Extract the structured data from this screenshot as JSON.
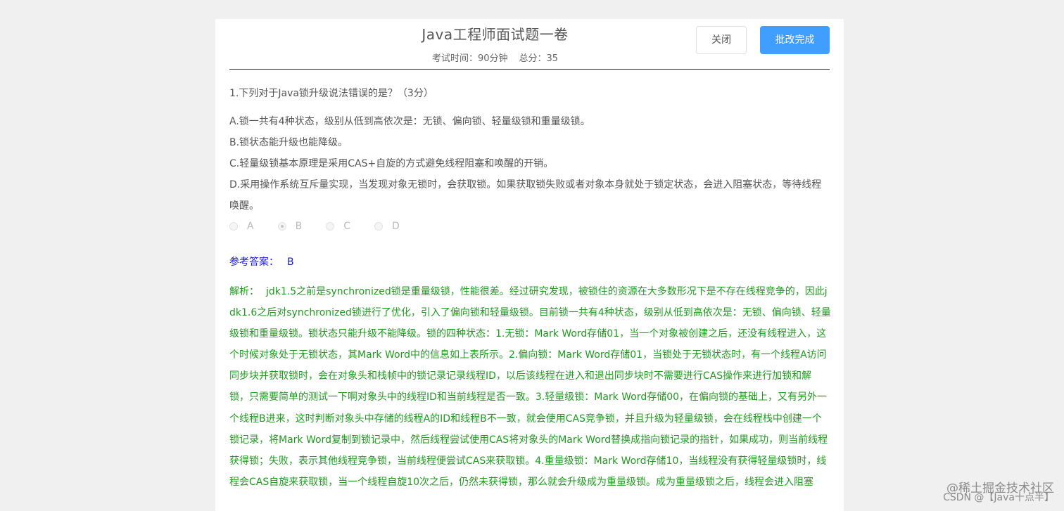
{
  "header": {
    "title": "Java工程师面试题一卷",
    "exam_time": "考试时间：90分钟",
    "total_score": "总分：35",
    "close_label": "关闭",
    "done_label": "批改完成"
  },
  "question": {
    "text": "1.下列对于Java锁升级说法错误的是？（3分）",
    "options": [
      "A.锁一共有4种状态，级别从低到高依次是：无锁、偏向锁、轻量级锁和重量级锁。",
      "B.锁状态能升级也能降级。",
      "C.轻量级锁基本原理是采用CAS+自旋的方式避免线程阻塞和唤醒的开销。",
      "D.采用操作系统互斥量实现，当发现对象无锁时，会获取锁。如果获取锁失败或者对象本身就处于锁定状态，会进入阻塞状态，等待线程唤醒。"
    ],
    "choices": [
      "A",
      "B",
      "C",
      "D"
    ],
    "selected": "B"
  },
  "answer": {
    "label": "参考答案：",
    "value": "B"
  },
  "analysis": {
    "label": "解析：",
    "text": "jdk1.5之前是synchronized锁是重量级锁，性能很差。经过研究发现，被锁住的资源在大多数形况下是不存在线程竞争的，因此jdk1.6之后对synchronized锁进行了优化，引入了偏向锁和轻量级锁。目前锁一共有4种状态，级别从低到高依次是：无锁、偏向锁、轻量级锁和重量级锁。锁状态只能升级不能降级。锁的四种状态：1.无锁：Mark Word存储01，当一个对象被创建之后，还没有线程进入，这个时候对象处于无锁状态，其Mark Word中的信息如上表所示。2.偏向锁：Mark Word存储01，当锁处于无锁状态时，有一个线程A访问同步块并获取锁时，会在对象头和栈帧中的锁记录记录线程ID，以后该线程在进入和退出同步块时不需要进行CAS操作来进行加锁和解锁，只需要简单的测试一下啊对象头中的线程ID和当前线程是否一致。3.轻量级锁：Mark Word存储00，在偏向锁的基础上，又有另外一个线程B进来，这时判断对象头中存储的线程A的ID和线程B不一致，就会使用CAS竞争锁，并且升级为轻量级锁，会在线程栈中创建一个锁记录，将Mark Word复制到锁记录中，然后线程尝试使用CAS将对象头的Mark Word替换成指向锁记录的指针，如果成功，则当前线程获得锁；失败，表示其他线程竞争锁，当前线程便尝试CAS来获取锁。4.重量级锁：Mark Word存储10，当线程没有获得轻量级锁时，线程会CAS自旋来获取锁，当一个线程自旋10次之后，仍然未获得锁，那么就会升级成为重量级锁。成为重量级锁之后，线程会进入阻塞"
  },
  "watermark": {
    "line1": "@稀土掘金技术社区",
    "line2": "CSDN @【Java十点半】"
  },
  "colors": {
    "primary": "#409eff",
    "answer": "#1a1adb",
    "analysis": "#1f9a1f"
  }
}
